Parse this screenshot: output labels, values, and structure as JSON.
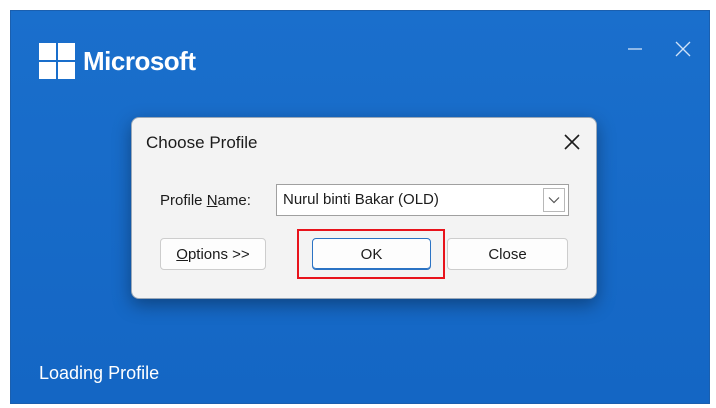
{
  "splash": {
    "brand": "Microsoft",
    "status": "Loading Profile"
  },
  "icons": {
    "logo": "microsoft-logo-icon",
    "minimize": "minimize-icon",
    "close": "close-icon",
    "dropdown": "chevron-down-icon"
  },
  "dialog": {
    "title": "Choose Profile",
    "profile_label_prefix": "Profile ",
    "profile_label_mnemonic": "N",
    "profile_label_suffix": "ame:",
    "profile_value": "Nurul binti Bakar (OLD)",
    "options_mnemonic": "O",
    "options_rest": "ptions >>",
    "ok_label": "OK",
    "close_label": "Close"
  },
  "colors": {
    "splash_background": "#1569c7",
    "highlight": "#e8131b",
    "ok_border": "#2b73c4"
  }
}
